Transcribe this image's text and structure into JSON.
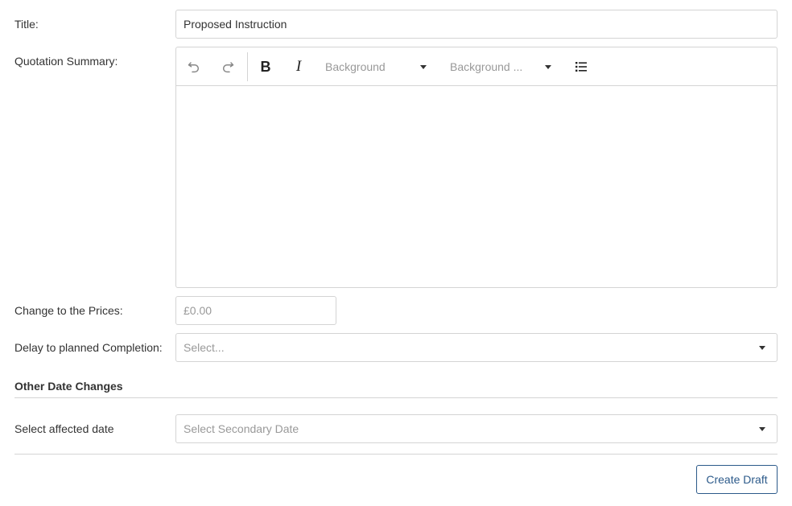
{
  "form": {
    "title_label": "Title:",
    "title_value": "Proposed Instruction",
    "summary_label": "Quotation Summary:",
    "toolbar": {
      "undo_icon": "undo-icon",
      "redo_icon": "redo-icon",
      "bold_glyph": "B",
      "italic_glyph": "I",
      "background_dropdown": "Background",
      "background_dropdown_2": "Background ...",
      "list_icon": "bullet-list-icon"
    },
    "summary_value": "",
    "prices_label": "Change to the Prices:",
    "prices_placeholder": "£0.00",
    "delay_label": "Delay to planned Completion:",
    "delay_placeholder": "Select...",
    "other_dates_heading": "Other Date Changes",
    "affected_date_label": "Select affected date",
    "affected_date_placeholder": "Select Secondary Date",
    "create_draft_button": "Create Draft"
  },
  "colors": {
    "border": "#d4d4d4",
    "text": "#333333",
    "placeholder": "#999999",
    "button_accent": "#2c5a8a"
  }
}
